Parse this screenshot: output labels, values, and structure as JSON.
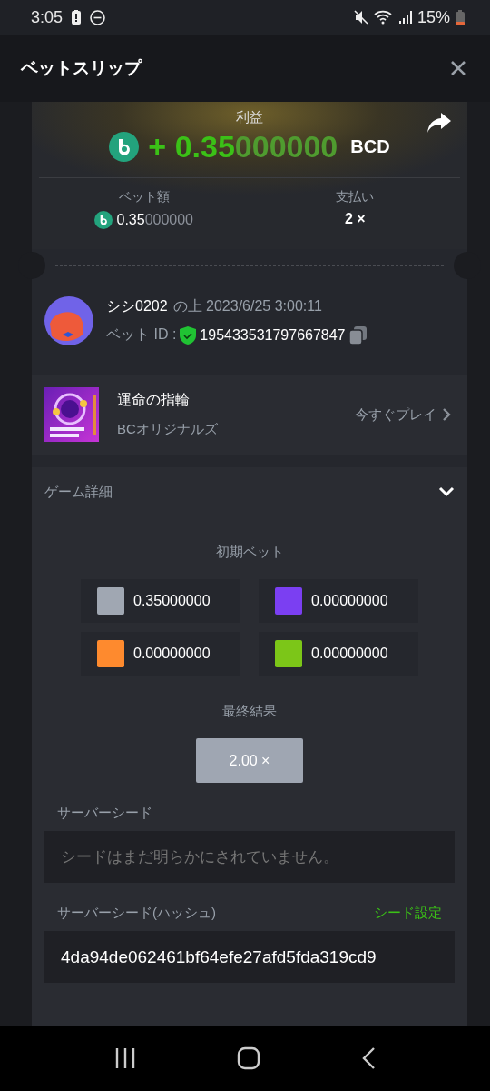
{
  "status_bar": {
    "time": "3:05",
    "battery": "15%"
  },
  "header": {
    "title": "ベットスリップ"
  },
  "profit": {
    "label": "利益",
    "amount": "+ 0.35000000",
    "currency": "BCD"
  },
  "bet": {
    "label": "ベット額",
    "amount": "0.35000000"
  },
  "payout": {
    "label": "支払い",
    "value": "2 ×"
  },
  "user": {
    "name": "シシ0202",
    "when": "の上 2023/6/25 3:00:11",
    "bet_id_label": "ベット ID :",
    "bet_id": "195433531797667847"
  },
  "game": {
    "name": "運命の指輪",
    "provider": "BCオリジナルズ",
    "play": "今すぐプレイ"
  },
  "details": {
    "title": "ゲーム詳細",
    "expanded": true,
    "initial_bet_label": "初期ベット",
    "bets": [
      {
        "color": "#a0a7b2",
        "amount": "0.35000000"
      },
      {
        "color": "#7b3ff2",
        "amount": "0.00000000"
      },
      {
        "color": "#fe8a2e",
        "amount": "0.00000000"
      },
      {
        "color": "#7cc618",
        "amount": "0.00000000"
      }
    ],
    "final_label": "最終結果",
    "final": "2.00 ×",
    "server_seed_label": "サーバーシード",
    "server_seed_placeholder": "シードはまだ明らかにされていません。",
    "hash_label": "サーバーシード(ハッシュ)",
    "seed_settings": "シード設定",
    "hash": "4da94de062461bf64efe27afd5fda319cd9"
  }
}
